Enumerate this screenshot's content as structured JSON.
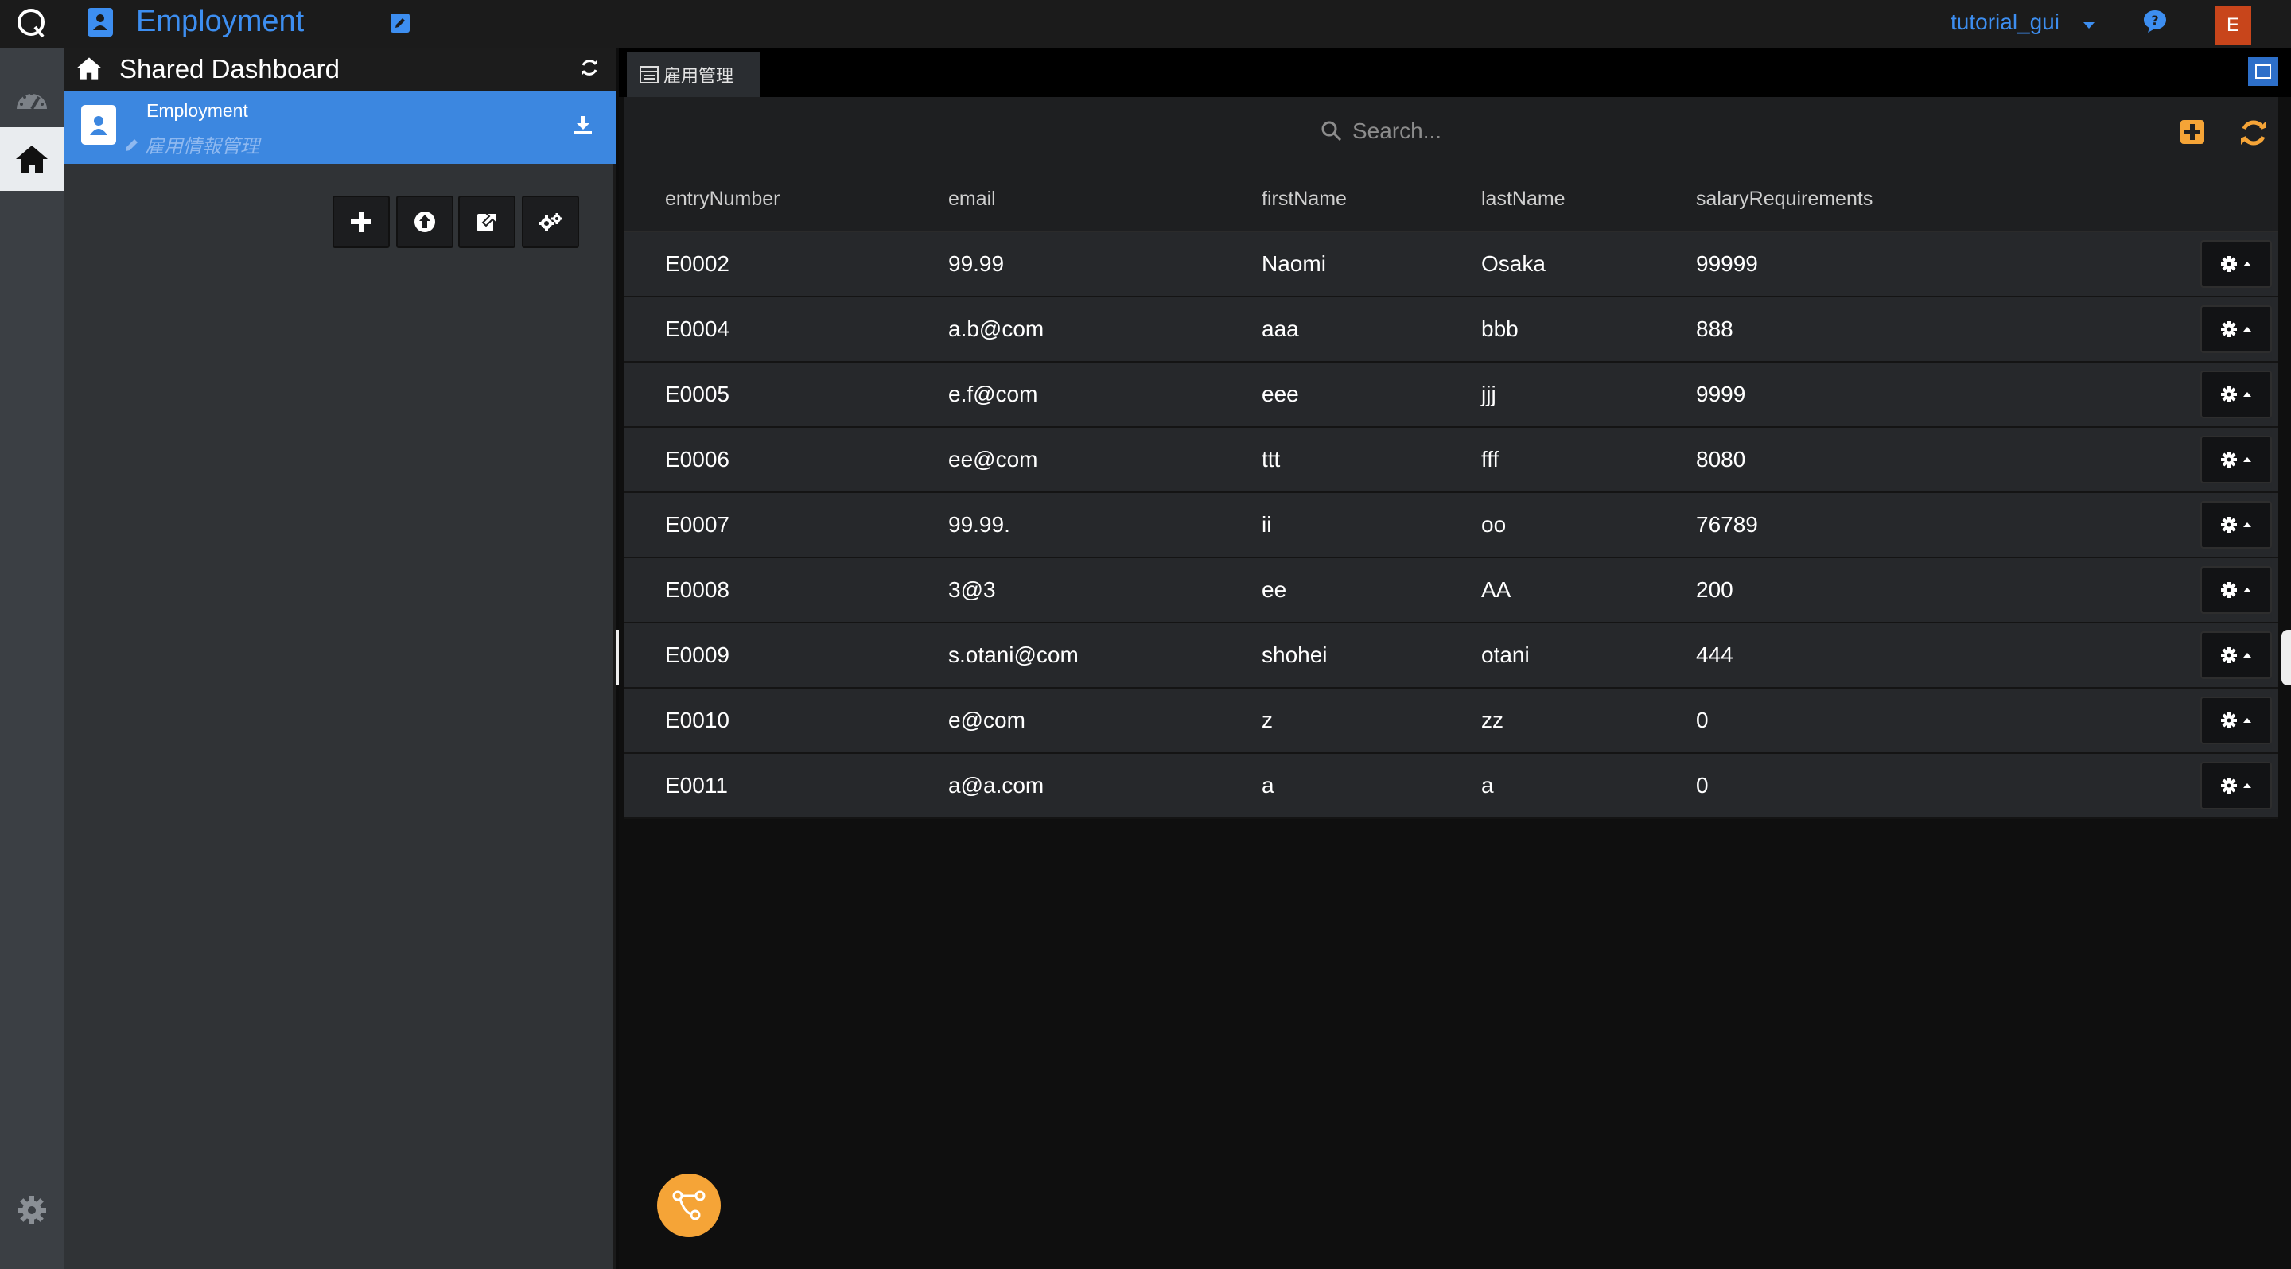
{
  "app": {
    "title": "Employment"
  },
  "user": {
    "name": "tutorial_gui",
    "initial": "E"
  },
  "sidebar": {
    "title": "Shared Dashboard",
    "item": {
      "title": "Employment",
      "subtitle": "雇用情報管理"
    }
  },
  "tab": {
    "label": "雇用管理"
  },
  "search": {
    "placeholder": "Search..."
  },
  "table": {
    "columns": [
      "entryNumber",
      "email",
      "firstName",
      "lastName",
      "salaryRequirements"
    ],
    "rows": [
      [
        "E0002",
        "99.99",
        "Naomi",
        "Osaka",
        "99999"
      ],
      [
        "E0004",
        "a.b@com",
        "aaa",
        "bbb",
        "888"
      ],
      [
        "E0005",
        "e.f@com",
        "eee",
        "jjj",
        "9999"
      ],
      [
        "E0006",
        "ee@com",
        "ttt",
        "fff",
        "8080"
      ],
      [
        "E0007",
        "99.99.",
        "ii",
        "oo",
        "76789"
      ],
      [
        "E0008",
        "3@3",
        "ee",
        "AA",
        "200"
      ],
      [
        "E0009",
        "s.otani@com",
        "shohei",
        "otani",
        "444"
      ],
      [
        "E0010",
        "e@com",
        "z",
        "zz",
        "0"
      ],
      [
        "E0011",
        "a@a.com",
        "a",
        "a",
        "0"
      ]
    ]
  },
  "colors": {
    "accent": "#3d8ef0",
    "highlight": "#3c87e0",
    "orange": "#f5a437",
    "avatar": "#c8451b"
  },
  "icons": [
    "q-logo-icon",
    "contact-card-icon",
    "edit-icon",
    "caret-down-icon",
    "help-icon",
    "dashboard-gauge-icon",
    "home-icon",
    "settings-gear-icon",
    "refresh-icon",
    "download-icon",
    "plus-icon",
    "upload-icon",
    "export-icon",
    "gears-icon",
    "table-icon",
    "maximize-icon",
    "search-icon",
    "add-square-icon",
    "sync-icon",
    "row-gear-icon",
    "flow-icon"
  ]
}
